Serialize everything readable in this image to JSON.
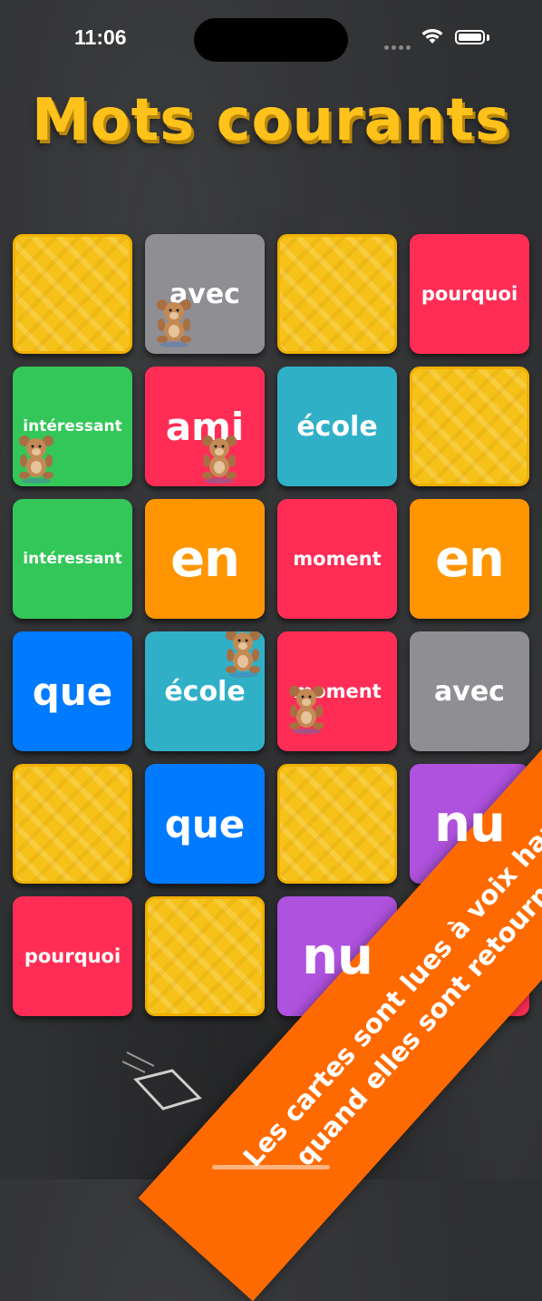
{
  "status": {
    "time": "11:06"
  },
  "title": "Mots courants",
  "colors": {
    "red": "#ff2d55",
    "green": "#33c759",
    "teal": "#30b0c7",
    "orange": "#ff9500",
    "blue": "#007aff",
    "gray": "#8e8e93",
    "purple": "#af52de",
    "gold": "#f6c21a"
  },
  "cards": [
    {
      "word": "",
      "state": "face-down"
    },
    {
      "word": "avec",
      "state": "face-up",
      "color": "gray"
    },
    {
      "word": "",
      "state": "face-down"
    },
    {
      "word": "pourquoi",
      "state": "face-up",
      "color": "red"
    },
    {
      "word": "intéressant",
      "state": "face-up",
      "color": "green"
    },
    {
      "word": "ami",
      "state": "face-up",
      "color": "red"
    },
    {
      "word": "école",
      "state": "face-up",
      "color": "teal"
    },
    {
      "word": "",
      "state": "face-down"
    },
    {
      "word": "intéressant",
      "state": "face-up",
      "color": "green"
    },
    {
      "word": "en",
      "state": "face-up",
      "color": "orange"
    },
    {
      "word": "moment",
      "state": "face-up",
      "color": "red"
    },
    {
      "word": "en",
      "state": "face-up",
      "color": "orange"
    },
    {
      "word": "que",
      "state": "face-up",
      "color": "blue"
    },
    {
      "word": "école",
      "state": "face-up",
      "color": "teal"
    },
    {
      "word": "moment",
      "state": "face-up",
      "color": "red"
    },
    {
      "word": "avec",
      "state": "face-up",
      "color": "gray"
    },
    {
      "word": "",
      "state": "face-down"
    },
    {
      "word": "que",
      "state": "face-up",
      "color": "blue"
    },
    {
      "word": "",
      "state": "face-down"
    },
    {
      "word": "nu",
      "state": "face-up",
      "color": "purple"
    },
    {
      "word": "pourquoi",
      "state": "face-up",
      "color": "red"
    },
    {
      "word": "",
      "state": "face-down"
    },
    {
      "word": "nu",
      "state": "face-up",
      "color": "purple"
    },
    {
      "word": "",
      "state": "face-up",
      "color": "red"
    }
  ],
  "banner": {
    "line1": "Les cartes sont lues à voix haute",
    "line2": "quand elles sont retournées"
  }
}
